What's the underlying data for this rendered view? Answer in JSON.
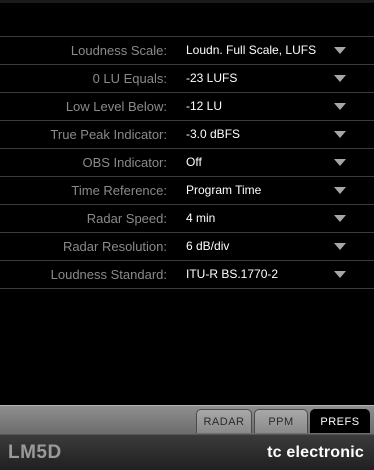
{
  "preferences": [
    {
      "label": "Loudness Scale:",
      "value": "Loudn. Full Scale, LUFS",
      "has_dropdown": true
    },
    {
      "label": "0 LU Equals:",
      "value": "-23 LUFS",
      "has_dropdown": true
    },
    {
      "label": "Low Level Below:",
      "value": "-12 LU",
      "has_dropdown": true
    },
    {
      "label": "True Peak Indicator:",
      "value": "-3.0 dBFS",
      "has_dropdown": true
    },
    {
      "label": "OBS Indicator:",
      "value": "Off",
      "has_dropdown": true
    },
    {
      "label": "Time Reference:",
      "value": "Program Time",
      "has_dropdown": true
    },
    {
      "label": "Radar Speed:",
      "value": "4 min",
      "has_dropdown": true
    },
    {
      "label": "Radar Resolution:",
      "value": "6 dB/div",
      "has_dropdown": true
    },
    {
      "label": "Loudness Standard:",
      "value": "ITU-R BS.1770-2",
      "has_dropdown": true
    }
  ],
  "tabs": [
    {
      "label": "RADAR",
      "active": false
    },
    {
      "label": "PPM",
      "active": false
    },
    {
      "label": "PREFS",
      "active": true
    }
  ],
  "footer": {
    "product_logo": "LM5D",
    "brand_logo": "tc electronic"
  },
  "colors": {
    "background": "#000000",
    "label_text": "#8a8a8a",
    "value_text": "#ffffff",
    "row_separator": "#3c3c3c",
    "dropdown_arrow": "#a6a6a6"
  }
}
